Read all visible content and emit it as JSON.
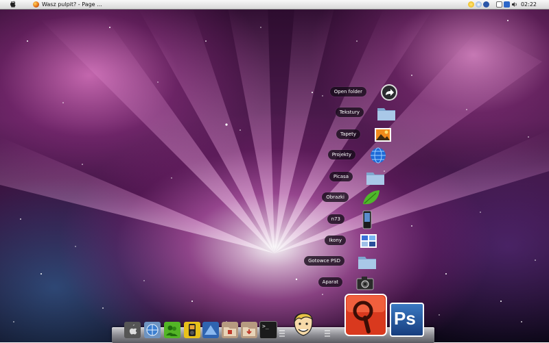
{
  "menubar": {
    "apple_icon": "apple-icon",
    "window_title": "Wasz pulpit? - Page ...",
    "clock": "02:22"
  },
  "stack": {
    "items": [
      {
        "label": "Open folder",
        "icon": "open-folder-arrow-icon"
      },
      {
        "label": "Tekstury",
        "icon": "folder-icon"
      },
      {
        "label": "Tapety",
        "icon": "wallpaper-image-icon"
      },
      {
        "label": "Projekty",
        "icon": "globe-icon"
      },
      {
        "label": "Picasa",
        "icon": "folder-icon"
      },
      {
        "label": "Obrazki",
        "icon": "leaf-icon"
      },
      {
        "label": "n73",
        "icon": "phone-icon"
      },
      {
        "label": "Ikony",
        "icon": "icons-image-icon"
      },
      {
        "label": "Gotowce PSD",
        "icon": "folder-icon"
      },
      {
        "label": "Aparat",
        "icon": "camera-icon"
      }
    ]
  },
  "dock": {
    "items": [
      {
        "icon": "apple-icon"
      },
      {
        "icon": "network-globe-icon"
      },
      {
        "icon": "messenger-icon"
      },
      {
        "icon": "media-player-icon"
      },
      {
        "icon": "blue-app-icon"
      },
      {
        "icon": "documents-folder-icon"
      },
      {
        "icon": "downloads-folder-icon"
      },
      {
        "icon": "terminal-icon",
        "text": ">_"
      },
      {
        "icon": "vault-boy-icon"
      },
      {
        "icon": "search-magnifier-icon"
      },
      {
        "icon": "photoshop-icon",
        "text": "Ps"
      }
    ]
  }
}
